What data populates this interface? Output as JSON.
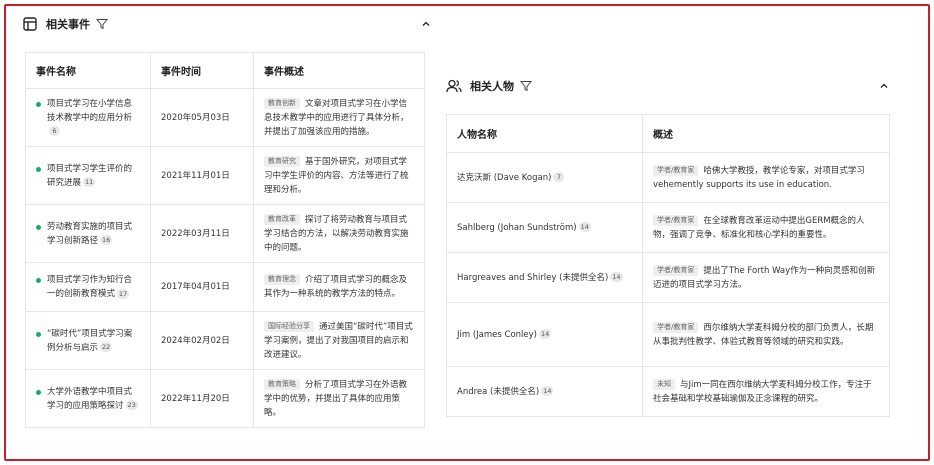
{
  "events_panel": {
    "title": "相关事件",
    "columns": [
      "事件名称",
      "事件时间",
      "事件概述"
    ],
    "rows": [
      {
        "name": "项目式学习在小学信息技术教学中的应用分析",
        "ref": "6",
        "time": "2020年05月03日",
        "tag": "教育创新",
        "desc": "文章对项目式学习在小学信息技术教学中的应用进行了具体分析，并提出了加强该应用的措施。"
      },
      {
        "name": "项目式学习学生评价的研究进展",
        "ref": "11",
        "time": "2021年11月01日",
        "tag": "教育研究",
        "desc": "基于国外研究，对项目式学习中学生评价的内容、方法等进行了梳理和分析。"
      },
      {
        "name": "劳动教育实施的项目式学习创新路径",
        "ref": "16",
        "time": "2022年03月11日",
        "tag": "教育改革",
        "desc": "探讨了将劳动教育与项目式学习结合的方法，以解决劳动教育实施中的问题。"
      },
      {
        "name": "项目式学习作为知行合一的创新教育模式",
        "ref": "17",
        "time": "2017年04月01日",
        "tag": "教育理念",
        "desc": "介绍了项目式学习的概念及其作为一种系统的教学方法的特点。"
      },
      {
        "name": "“碳时代”项目式学习案例分析与启示",
        "ref": "22",
        "time": "2024年02月02日",
        "tag": "国际经验分享",
        "desc": "通过美国“碳时代”项目式学习案例，提出了对我国项目的启示和改进建议。"
      },
      {
        "name": "大学外语教学中项目式学习的应用策略探讨",
        "ref": "23",
        "time": "2022年11月20日",
        "tag": "教育策略",
        "desc": "分析了项目式学习在外语教学中的优势，并提出了具体的应用策略。"
      }
    ]
  },
  "people_panel": {
    "title": "相关人物",
    "columns": [
      "人物名称",
      "概述"
    ],
    "rows": [
      {
        "name": "达克沃斯 (Dave Kogan)",
        "ref": "7",
        "tag": "学者/教育家",
        "desc": "哈佛大学教授，教学论专家，对项目式学习 vehemently supports its use in education."
      },
      {
        "name": "Sahlberg (Johan Sundström)",
        "ref": "14",
        "tag": "学者/教育家",
        "desc": "在全球教育改革运动中提出GERM概念的人物，强调了竞争、标准化和核心学科的重要性。"
      },
      {
        "name": "Hargreaves and Shirley (未提供全名)",
        "ref": "14",
        "tag": "学者/教育家",
        "desc": "提出了The Forth Way作为一种向灵感和创新迈进的项目式学习方法。"
      },
      {
        "name": "Jim (James Conley)",
        "ref": "14",
        "tag": "学者/教育家",
        "desc": "西尔维纳大学麦科姆分校的部门负责人，长期从事批判性教学、体验式教育等领域的研究和实践。"
      },
      {
        "name": "Andrea (未提供全名)",
        "ref": "14",
        "tag": "未知",
        "desc": "与Jim一同在西尔维纳大学麦科姆分校工作，专注于社会基础和学校基础瑜伽及正念课程的研究。"
      }
    ]
  },
  "icons": {
    "events_panel": "table-icon",
    "people_panel": "users-icon",
    "filter": "filter-icon",
    "collapse": "chevron-up-icon"
  },
  "colors": {
    "frame_border": "#c8202a",
    "bullet": "#1aaa6b",
    "tag_bg": "#eeeeee",
    "table_border": "#e6e6e6"
  }
}
